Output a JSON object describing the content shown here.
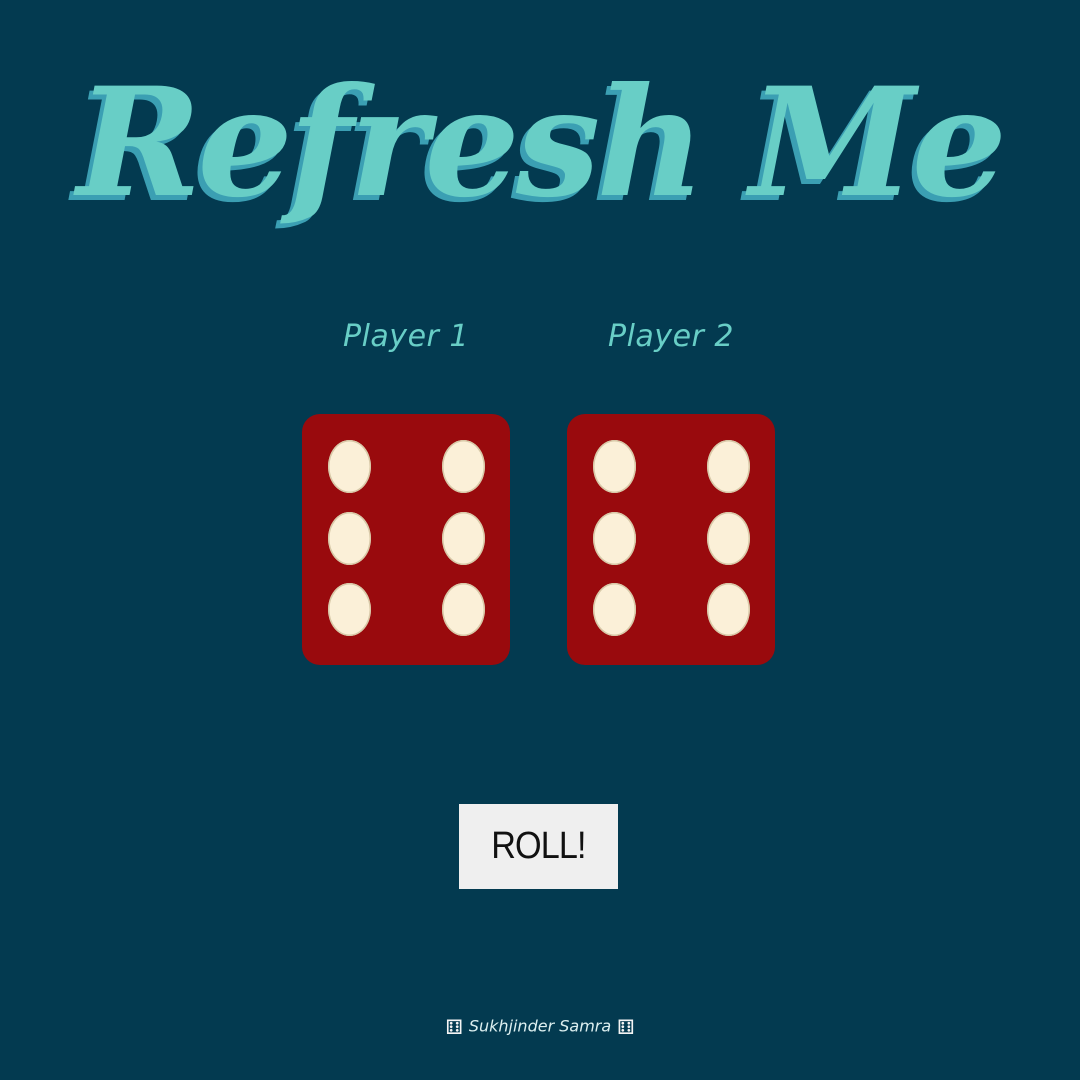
{
  "title": "Refresh Me",
  "players": [
    {
      "label": "Player 1",
      "die_value": 6
    },
    {
      "label": "Player 2",
      "die_value": 6
    }
  ],
  "roll_button": {
    "label": "ROLL!"
  },
  "footer": {
    "author": "Sukhjinder Samra",
    "left_icon": "dice-icon",
    "right_icon": "dice-icon",
    "icon_glyph": "⚅"
  },
  "colors": {
    "background": "#033a50",
    "title": "#68cec6",
    "title_shadow": "#3b9fb3",
    "die_face": "#990a0d",
    "die_pip": "#fbf0d8",
    "button_bg": "#efefef"
  }
}
